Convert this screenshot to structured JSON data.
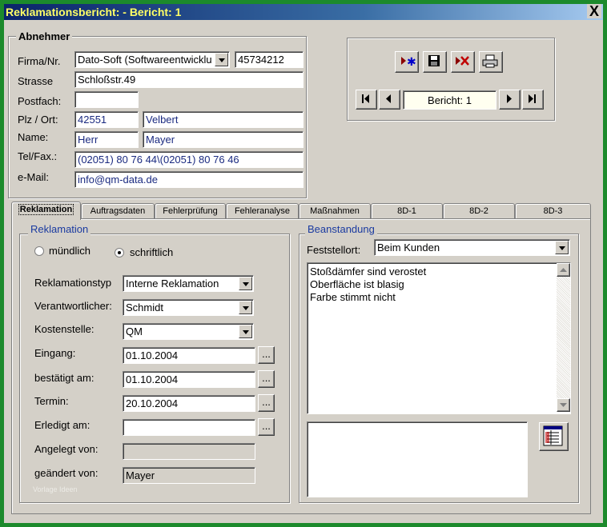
{
  "window": {
    "title": "Reklamationsbericht:  - Bericht: 1",
    "close_glyph": "X"
  },
  "customer": {
    "legend": "Abnehmer",
    "company_label": "Firma/Nr.",
    "company": "Dato-Soft (Softwareentwicklu",
    "number": "45734212",
    "street_label": "Strasse",
    "street": "Schloßstr.49",
    "pobox_label": "Postfach:",
    "pobox": "",
    "city_label": "Plz / Ort:",
    "zip": "42551",
    "city": "Velbert",
    "name_label": "Name:",
    "salutation": "Herr",
    "lastname": "Mayer",
    "phone_label": "Tel/Fax.:",
    "phone": "(02051) 80 76 44\\(02051) 80 76 46",
    "email_label": "e-Mail:",
    "email": "info@qm-data.de"
  },
  "navigator": {
    "record": "Bericht: 1"
  },
  "tabs": [
    "Reklamation",
    "Auftragsdaten",
    "Fehlerprüfung",
    "Fehleranalyse",
    "Maßnahmen",
    "8D-1",
    "8D-2",
    "8D-3"
  ],
  "complaint": {
    "legend": "Reklamation",
    "oral": "mündlich",
    "written": "schriftlich",
    "selected": "schriftlich",
    "type_label": "Reklamationstyp",
    "type": "Interne Reklamation",
    "responsible_label": "Verantwortlicher:",
    "responsible": "Schmidt",
    "costcenter_label": "Kostenstelle:",
    "costcenter": "QM",
    "received_label": "Eingang:",
    "received": "01.10.2004",
    "confirmed_label": "bestätigt am:",
    "confirmed": "01.10.2004",
    "deadline_label": "Termin:",
    "deadline": "20.10.2004",
    "done_label": "Erledigt am:",
    "done": "",
    "created_label": "Angelegt von:",
    "created": "",
    "changed_label": "geändert von:",
    "changed": "Mayer",
    "watermark": "Vorlage Ideen",
    "dots": "..."
  },
  "issue": {
    "legend": "Beanstandung",
    "location_label": "Feststellort:",
    "location": "Beim Kunden",
    "lines": [
      "Stoßdämfer sind verostet",
      "Oberfläche ist blasig",
      "Farbe stimmt nicht"
    ],
    "notes": ""
  }
}
